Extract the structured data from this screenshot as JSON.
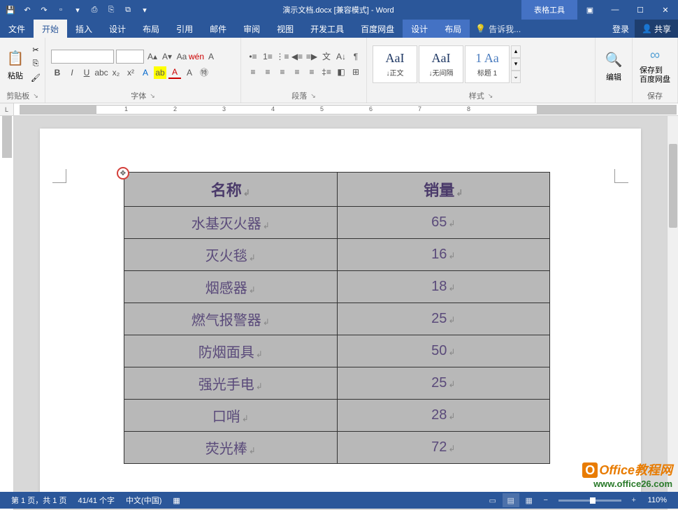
{
  "titlebar": {
    "doc_title": "演示文档.docx [兼容模式] - Word",
    "table_tools": "表格工具"
  },
  "menu": {
    "file": "文件",
    "home": "开始",
    "insert": "插入",
    "design": "设计",
    "layout": "布局",
    "references": "引用",
    "mailings": "邮件",
    "review": "审阅",
    "view": "视图",
    "developer": "开发工具",
    "baidu": "百度网盘",
    "t_design": "设计",
    "t_layout": "布局",
    "tell_me": "告诉我...",
    "login": "登录",
    "share": "共享"
  },
  "ribbon": {
    "clipboard": {
      "label": "剪贴板",
      "paste": "粘贴"
    },
    "font": {
      "label": "字体"
    },
    "paragraph": {
      "label": "段落"
    },
    "styles": {
      "label": "样式",
      "items": [
        {
          "preview": "AaI",
          "name": "↓正文"
        },
        {
          "preview": "AaI",
          "name": "↓无间隔"
        },
        {
          "preview": "1 Aa",
          "name": "标题 1"
        }
      ]
    },
    "editing": {
      "label": "编辑"
    },
    "save": {
      "label": "保存",
      "btn": "保存到\n百度网盘"
    }
  },
  "table": {
    "headers": [
      "名称",
      "销量"
    ],
    "rows": [
      [
        "水基灭火器",
        "65"
      ],
      [
        "灭火毯",
        "16"
      ],
      [
        "烟感器",
        "18"
      ],
      [
        "燃气报警器",
        "25"
      ],
      [
        "防烟面具",
        "50"
      ],
      [
        "强光手电",
        "25"
      ],
      [
        "口哨",
        "28"
      ],
      [
        "荧光棒",
        "72"
      ]
    ]
  },
  "statusbar": {
    "page": "第 1 页，共 1 页",
    "words": "41/41 个字",
    "lang": "中文(中国)",
    "zoom": "110%"
  },
  "watermark": {
    "line1": "Office教程网",
    "line2": "www.office26.com"
  }
}
